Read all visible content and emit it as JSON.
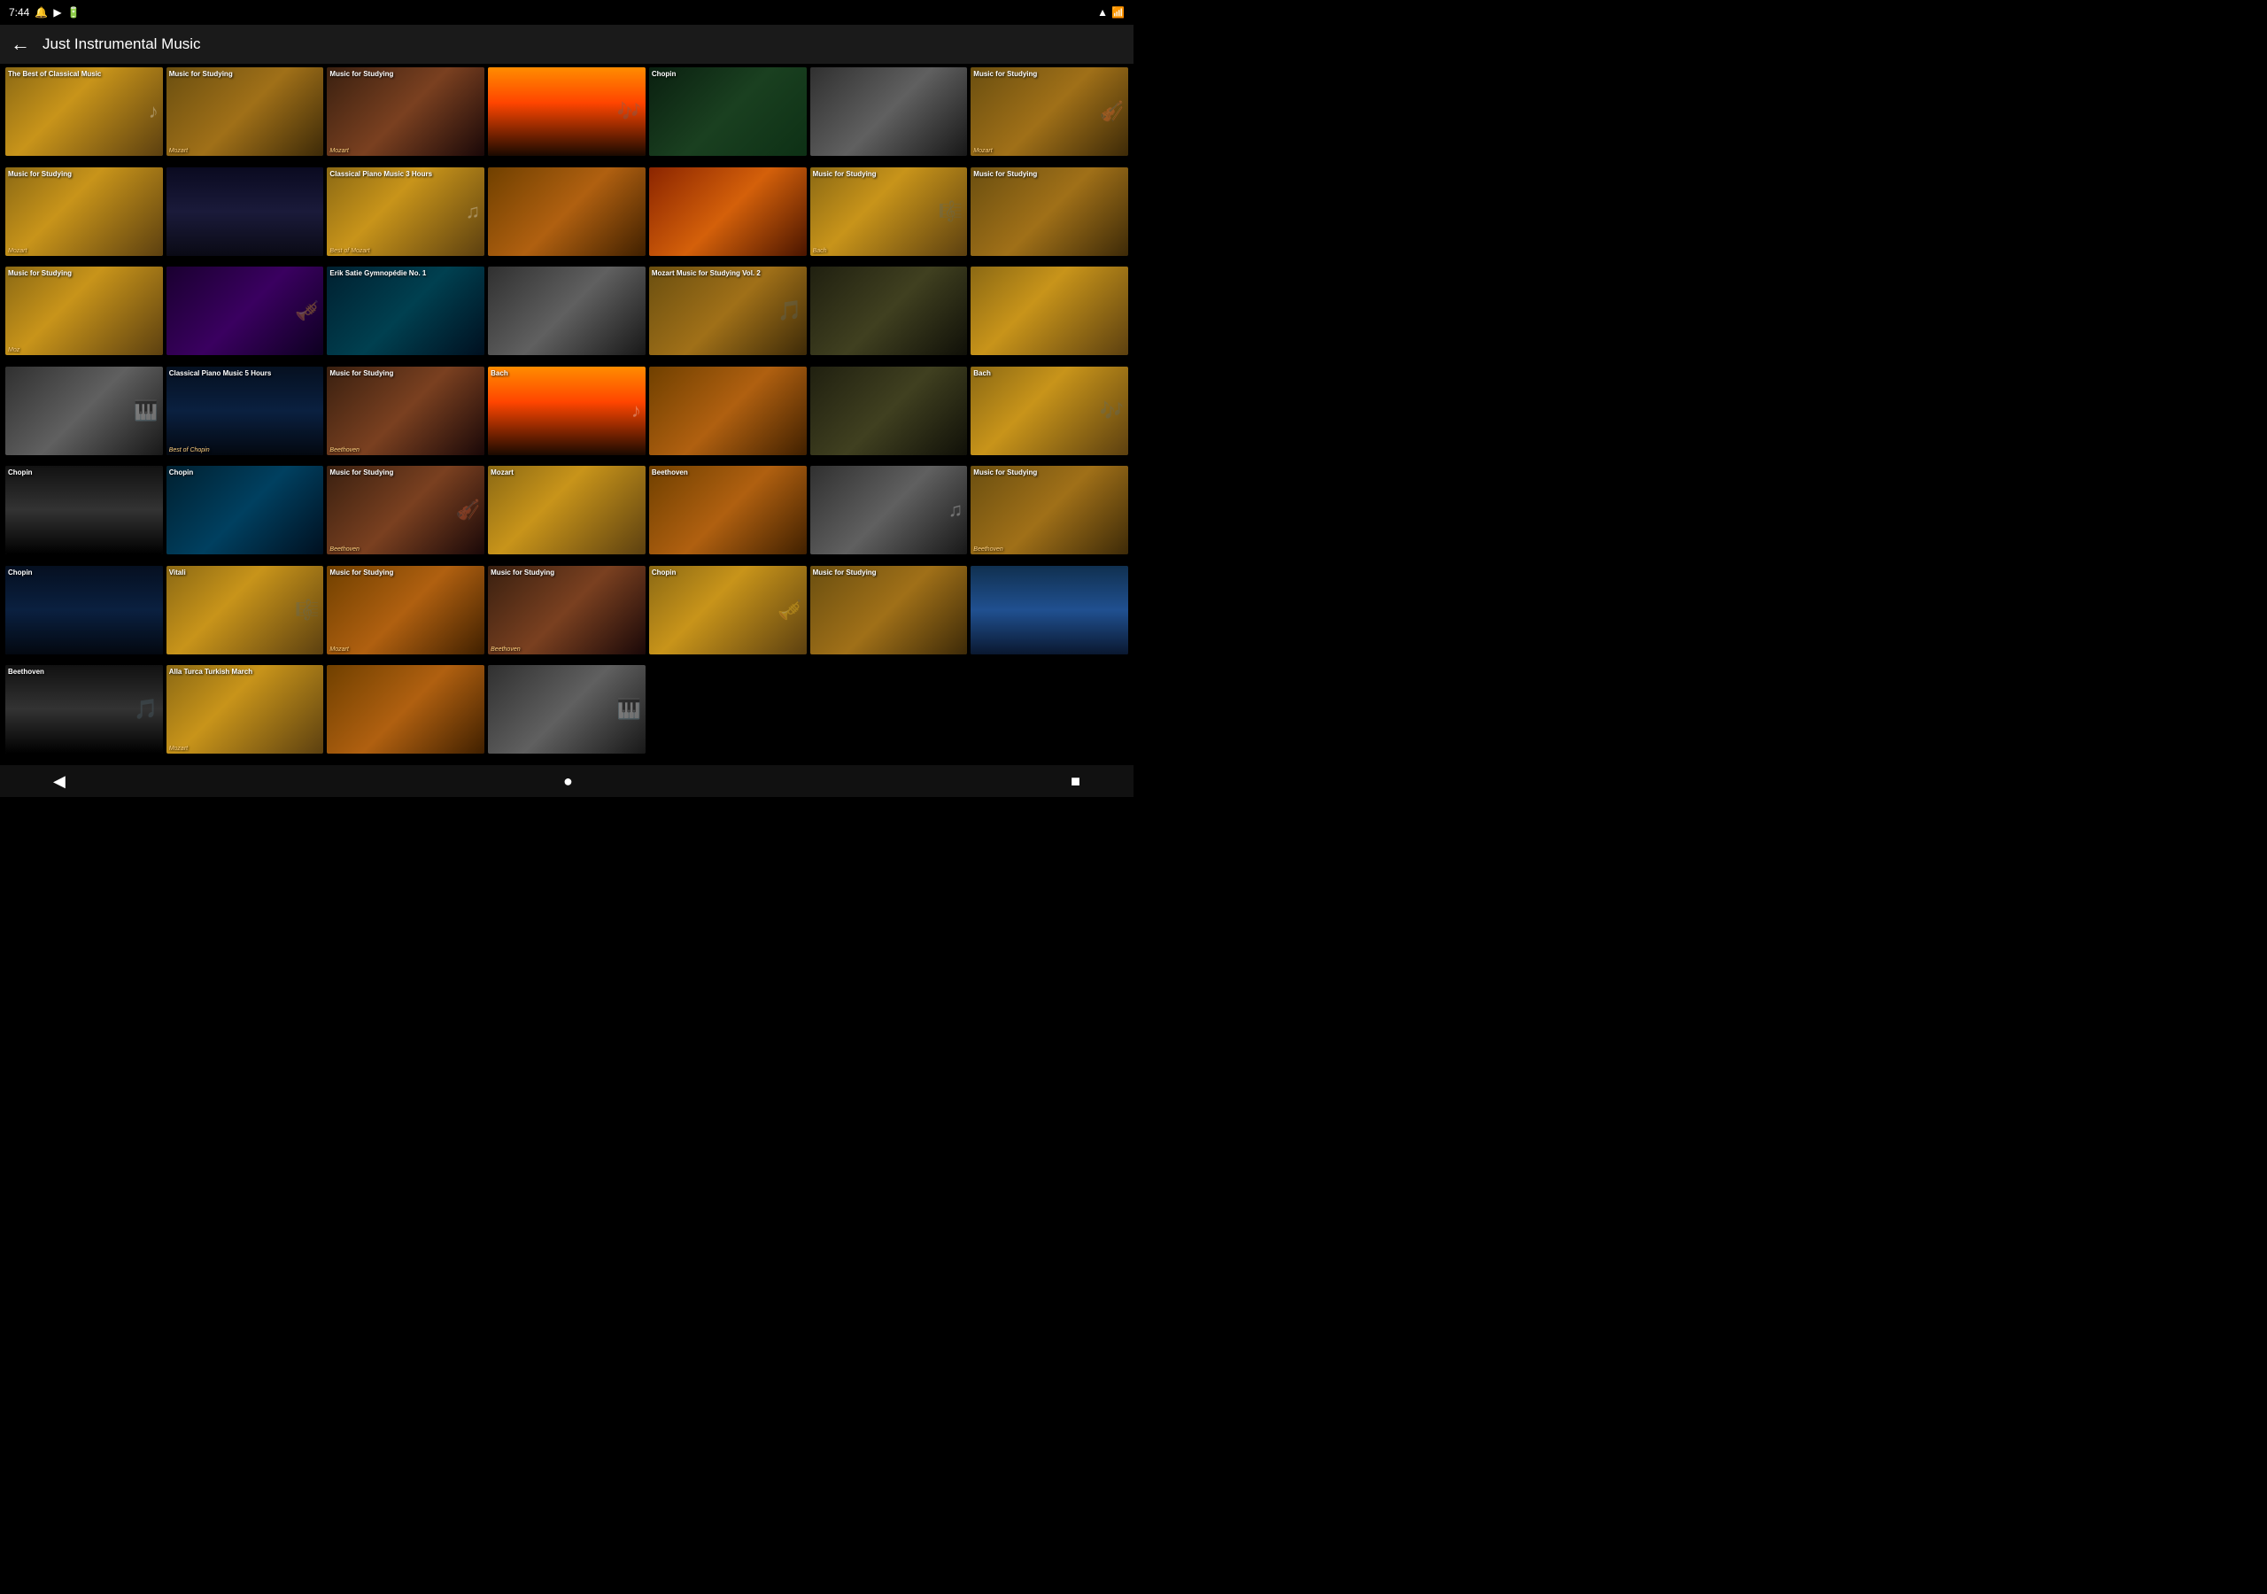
{
  "statusBar": {
    "time": "7:44",
    "rightIcons": [
      "wifi",
      "battery"
    ]
  },
  "header": {
    "title": "Just Instrumental Music"
  },
  "cards": [
    {
      "id": 1,
      "label": "The Best of Classical Music",
      "sublabel": "",
      "theme": "theme-amber",
      "topLabel": ""
    },
    {
      "id": 2,
      "label": "Music for Studying",
      "sublabel": "Mozart",
      "theme": "theme-dark-amber",
      "topLabel": ""
    },
    {
      "id": 3,
      "label": "Music for Studying",
      "sublabel": "Mozart",
      "theme": "theme-warm",
      "topLabel": ""
    },
    {
      "id": 4,
      "label": "",
      "sublabel": "",
      "theme": "theme-sunset",
      "topLabel": ""
    },
    {
      "id": 5,
      "label": "Chopin",
      "sublabel": "",
      "theme": "theme-forest",
      "topLabel": ""
    },
    {
      "id": 6,
      "label": "",
      "sublabel": "",
      "theme": "theme-silver",
      "topLabel": ""
    },
    {
      "id": 7,
      "label": "Music for Studying",
      "sublabel": "Mozart",
      "theme": "theme-dark-amber",
      "topLabel": ""
    },
    {
      "id": 8,
      "label": "Music for Studying",
      "sublabel": "Mozart",
      "theme": "theme-amber",
      "topLabel": ""
    },
    {
      "id": 9,
      "label": "",
      "sublabel": "",
      "theme": "theme-night",
      "topLabel": ""
    },
    {
      "id": 10,
      "label": "Classical Piano Music 3 Hours",
      "sublabel": "Best of Mozart",
      "theme": "theme-amber",
      "topLabel": ""
    },
    {
      "id": 11,
      "label": "",
      "sublabel": "",
      "theme": "theme-gold",
      "topLabel": ""
    },
    {
      "id": 12,
      "label": "",
      "sublabel": "",
      "theme": "theme-autumn",
      "topLabel": ""
    },
    {
      "id": 13,
      "label": "Music for Studying",
      "sublabel": "Bach",
      "theme": "theme-amber",
      "topLabel": ""
    },
    {
      "id": 14,
      "label": "Music for Studying",
      "sublabel": "",
      "theme": "theme-dark-amber",
      "topLabel": ""
    },
    {
      "id": 15,
      "label": "Music for Studying",
      "sublabel": "Moz",
      "theme": "theme-amber",
      "topLabel": ""
    },
    {
      "id": 16,
      "label": "",
      "sublabel": "",
      "theme": "theme-purple",
      "topLabel": ""
    },
    {
      "id": 17,
      "label": "Erik Satie Gymnopédie No. 1",
      "sublabel": "",
      "theme": "theme-teal",
      "topLabel": ""
    },
    {
      "id": 18,
      "label": "",
      "sublabel": "",
      "theme": "theme-silver",
      "topLabel": ""
    },
    {
      "id": 19,
      "label": "Mozart Music for Studying Vol. 2",
      "sublabel": "",
      "theme": "theme-dark-amber",
      "topLabel": ""
    },
    {
      "id": 20,
      "label": "",
      "sublabel": "",
      "theme": "theme-olive",
      "topLabel": ""
    },
    {
      "id": 21,
      "label": "",
      "sublabel": "",
      "theme": "theme-amber",
      "topLabel": ""
    },
    {
      "id": 22,
      "label": "",
      "sublabel": "",
      "theme": "theme-silver",
      "topLabel": ""
    },
    {
      "id": 23,
      "label": "Classical Piano Music 5 Hours",
      "sublabel": "Best of Chopin",
      "theme": "theme-blue",
      "topLabel": ""
    },
    {
      "id": 24,
      "label": "Music for Studying",
      "sublabel": "Beethoven",
      "theme": "theme-warm",
      "topLabel": ""
    },
    {
      "id": 25,
      "label": "Bach",
      "sublabel": "",
      "theme": "theme-sunset",
      "topLabel": ""
    },
    {
      "id": 26,
      "label": "",
      "sublabel": "",
      "theme": "theme-gold",
      "topLabel": ""
    },
    {
      "id": 27,
      "label": "",
      "sublabel": "",
      "theme": "theme-olive",
      "topLabel": ""
    },
    {
      "id": 28,
      "label": "Bach",
      "sublabel": "",
      "theme": "theme-amber",
      "topLabel": ""
    },
    {
      "id": 29,
      "label": "Chopin",
      "sublabel": "",
      "theme": "theme-piano",
      "topLabel": ""
    },
    {
      "id": 30,
      "label": "Chopin",
      "sublabel": "",
      "theme": "theme-cyan",
      "topLabel": ""
    },
    {
      "id": 31,
      "label": "Music for Studying",
      "sublabel": "Beethoven",
      "theme": "theme-warm",
      "topLabel": ""
    },
    {
      "id": 32,
      "label": "Mozart",
      "sublabel": "",
      "theme": "theme-amber",
      "topLabel": ""
    },
    {
      "id": 33,
      "label": "Beethoven",
      "sublabel": "",
      "theme": "theme-gold",
      "topLabel": ""
    },
    {
      "id": 34,
      "label": "",
      "sublabel": "",
      "theme": "theme-silver",
      "topLabel": ""
    },
    {
      "id": 35,
      "label": "Music for Studying",
      "sublabel": "Beethoven",
      "theme": "theme-dark-amber",
      "topLabel": ""
    },
    {
      "id": 36,
      "label": "Chopin",
      "sublabel": "",
      "theme": "theme-lake",
      "topLabel": ""
    },
    {
      "id": 37,
      "label": "Vitali",
      "sublabel": "",
      "theme": "theme-amber",
      "topLabel": ""
    },
    {
      "id": 38,
      "label": "Music for Studying",
      "sublabel": "Mozart",
      "theme": "theme-gold",
      "topLabel": ""
    },
    {
      "id": 39,
      "label": "Music for Studying",
      "sublabel": "Beethoven",
      "theme": "theme-warm",
      "topLabel": ""
    },
    {
      "id": 40,
      "label": "Chopin",
      "sublabel": "",
      "theme": "theme-amber",
      "topLabel": ""
    },
    {
      "id": 41,
      "label": "Music for Studying",
      "sublabel": "",
      "theme": "theme-dark-amber",
      "topLabel": ""
    },
    {
      "id": 42,
      "label": "",
      "sublabel": "",
      "theme": "theme-sky",
      "topLabel": ""
    },
    {
      "id": 43,
      "label": "Beethoven",
      "sublabel": "",
      "theme": "theme-piano",
      "topLabel": ""
    },
    {
      "id": 44,
      "label": "Alla Turca Turkish March",
      "sublabel": "Mozart",
      "theme": "theme-amber",
      "topLabel": ""
    },
    {
      "id": 45,
      "label": "",
      "sublabel": "",
      "theme": "theme-gold",
      "topLabel": ""
    },
    {
      "id": 46,
      "label": "",
      "sublabel": "",
      "theme": "theme-silver",
      "topLabel": ""
    }
  ],
  "bottomNav": {
    "back": "◀",
    "home": "●",
    "square": "■"
  }
}
